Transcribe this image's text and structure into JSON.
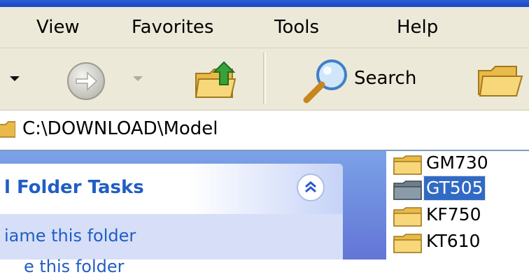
{
  "menu": {
    "items": [
      "View",
      "Favorites",
      "Tools",
      "Help"
    ]
  },
  "toolbar": {
    "back_icon": "back-arrow-icon",
    "forward_icon": "forward-arrow-icon",
    "up_icon": "up-folder-icon",
    "search_icon": "search-icon",
    "search_label": "Search",
    "folders_icon": "folders-icon"
  },
  "address": {
    "path": "C:\\DOWNLOAD\\Model"
  },
  "tasks": {
    "title": "l Folder Tasks",
    "link_rename": "iame this folder",
    "link_move": "e this folder",
    "collapse_icon": "chevron-up-icon"
  },
  "folders": [
    {
      "name": "GM730",
      "selected": false
    },
    {
      "name": "GT505",
      "selected": true
    },
    {
      "name": "KF750",
      "selected": false
    },
    {
      "name": "KT610",
      "selected": false
    }
  ],
  "colors": {
    "title_blue": "#215dc6",
    "selection": "#316ac5",
    "chrome": "#ece9d8",
    "task_pane": "#7ba2e7"
  }
}
